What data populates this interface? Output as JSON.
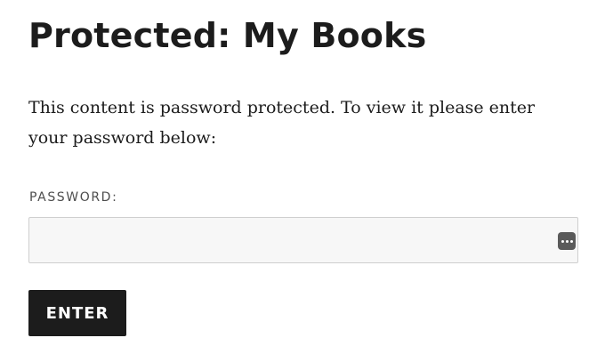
{
  "page": {
    "title": "Protected: My Books",
    "intro": "This content is password protected. To view it please enter your password below:"
  },
  "form": {
    "password_label": "PASSWORD:",
    "password_value": "",
    "enter_label": "ENTER",
    "password_manager_icon": "password-manager-dots-icon"
  },
  "colors": {
    "text": "#1c1c1c",
    "label": "#4d4d4d",
    "field_background": "#f7f7f7",
    "field_border": "#cfcfcf",
    "button_background": "#1c1c1c",
    "button_text": "#ffffff",
    "icon_background": "#5a5a5a"
  }
}
